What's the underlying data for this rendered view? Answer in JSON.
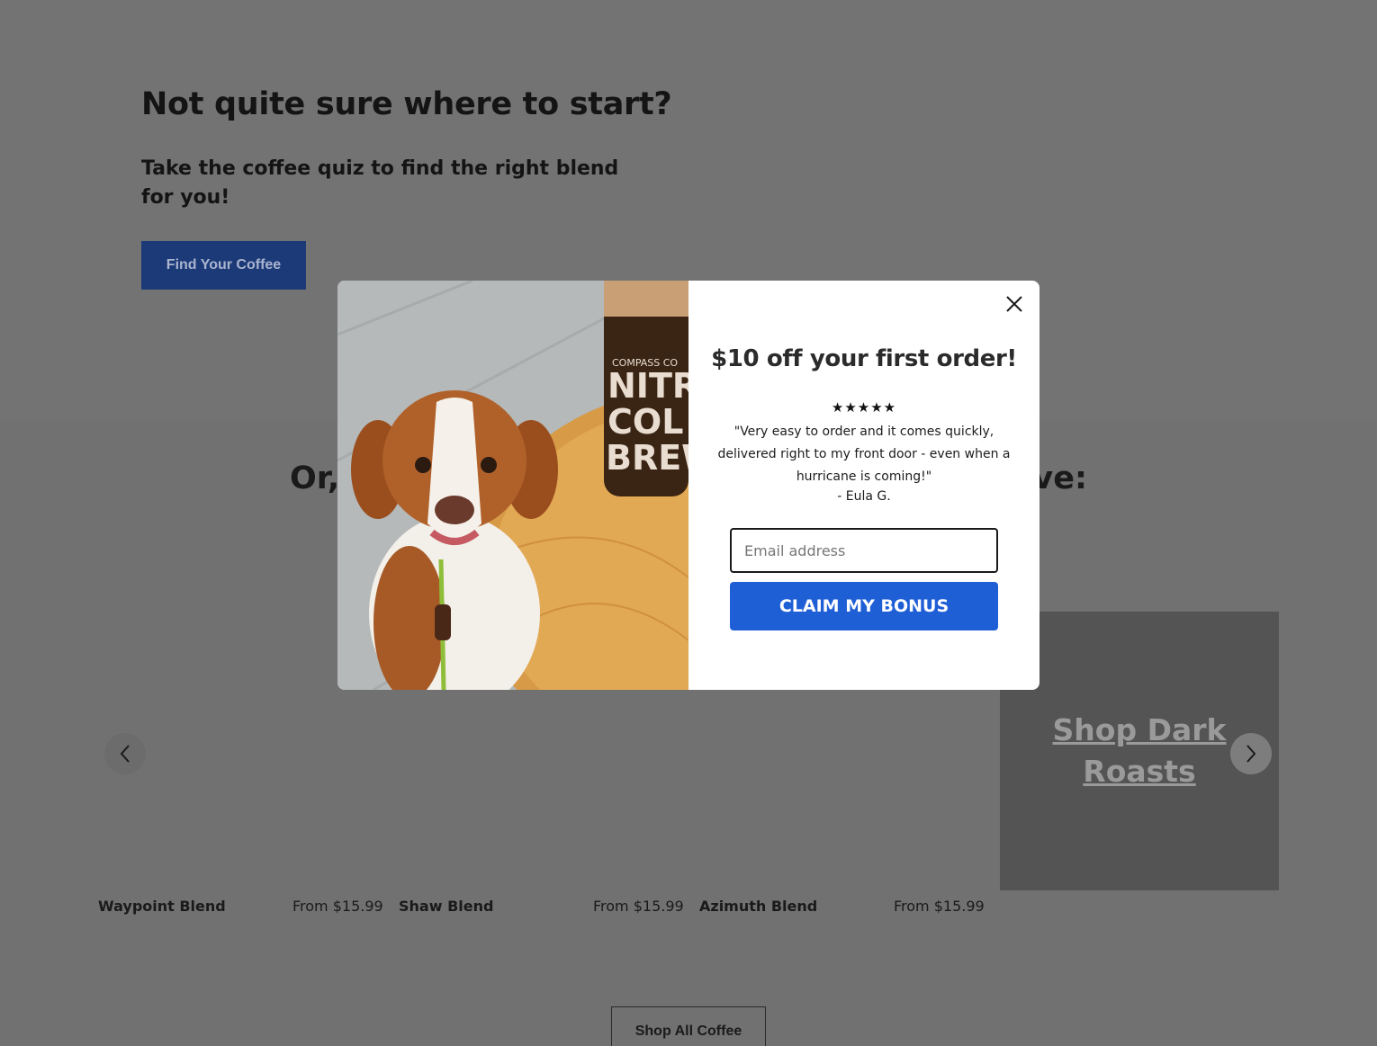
{
  "quiz": {
    "title": "Not quite sure where to start?",
    "subtitle": "Take the coffee quiz to find the right blend for you!",
    "button_label": "Find Your Coffee"
  },
  "shop": {
    "title_visible_left": "Or, j",
    "title_visible_right": "ove:",
    "products": [
      {
        "name": "Waypoint Blend",
        "price": "From $15.99"
      },
      {
        "name": "Shaw Blend",
        "price": "From $15.99"
      },
      {
        "name": "Azimuth Blend",
        "price": "From $15.99"
      }
    ],
    "dark_roasts_label": "Shop Dark Roasts",
    "prev_icon": "chevron-left-icon",
    "next_icon": "chevron-right-icon",
    "shop_all_label": "Shop All Coffee"
  },
  "modal": {
    "image_text": {
      "brand": "COMPASS CO",
      "line1": "NITR",
      "line2": "COL",
      "line3": "BREW"
    },
    "title": "$10 off your first order!",
    "stars": "★★★★★",
    "quote": "\"Very easy to order and it comes quickly, delivered right to my front door - even when a hurricane is coming!\"",
    "author": "- Eula G.",
    "email_placeholder": "Email address",
    "email_value": "",
    "claim_label": "CLAIM MY BONUS",
    "close_icon": "close-icon"
  },
  "colors": {
    "overlay_bg": "#737373",
    "quiz_button": "#1d3a78",
    "claim_button": "#1f5fd6"
  }
}
